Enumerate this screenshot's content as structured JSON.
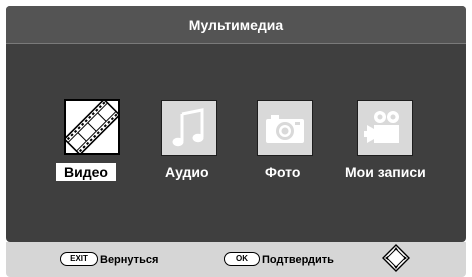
{
  "header": {
    "title": "Мультимедиа"
  },
  "menu": {
    "items": [
      {
        "label": "Видео",
        "icon": "film-strip-icon",
        "selected": true
      },
      {
        "label": "Аудио",
        "icon": "music-note-icon",
        "selected": false
      },
      {
        "label": "Фото",
        "icon": "camera-icon",
        "selected": false
      },
      {
        "label": "Мои записи",
        "icon": "video-camera-icon",
        "selected": false
      }
    ]
  },
  "footer": {
    "exit_key": "EXIT",
    "exit_label": "Вернуться",
    "ok_key": "OK",
    "ok_label": "Подтвердить",
    "nav_icon": "dpad-icon"
  },
  "colors": {
    "panel": "#3f3f3f",
    "titlebar": "#545454",
    "footer": "#d6d6d6",
    "icon_bg": "#d9d9d9",
    "selected_bg": "#ffffff"
  }
}
